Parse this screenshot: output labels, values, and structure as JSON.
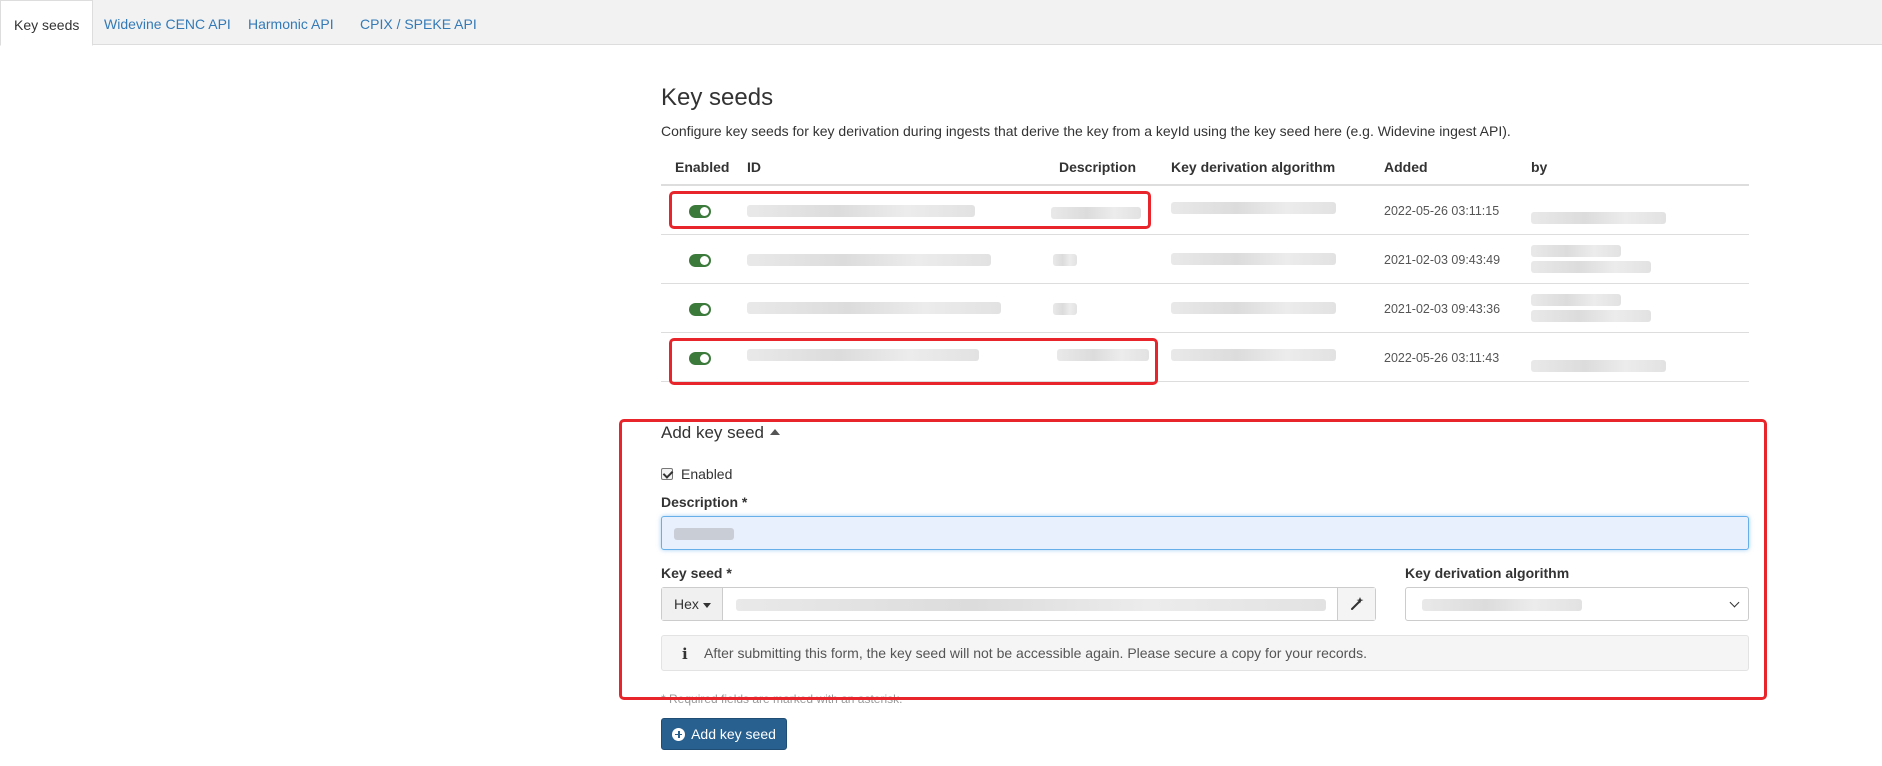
{
  "tabs": [
    {
      "label": "Key seeds",
      "active": true
    },
    {
      "label": "Widevine CENC API",
      "active": false
    },
    {
      "label": "Harmonic API",
      "active": false
    },
    {
      "label": "CPIX / SPEKE API",
      "active": false
    }
  ],
  "page": {
    "title": "Key seeds",
    "description": "Configure key seeds for key derivation during ingests that derive the key from a keyId using the key seed here (e.g. Widevine ingest API)."
  },
  "table": {
    "headers": {
      "enabled": "Enabled",
      "id": "ID",
      "description": "Description",
      "algorithm": "Key derivation algorithm",
      "added": "Added",
      "by": "by"
    },
    "rows": [
      {
        "enabled": true,
        "added": "2022-05-26 03:11:15"
      },
      {
        "enabled": true,
        "added": "2021-02-03 09:43:49"
      },
      {
        "enabled": true,
        "added": "2021-02-03 09:43:36"
      },
      {
        "enabled": true,
        "added": "2022-05-26 03:11:43"
      }
    ]
  },
  "form": {
    "title": "Add key seed",
    "enabled_label": "Enabled",
    "description_label": "Description *",
    "key_seed_label": "Key seed *",
    "format_label": "Hex",
    "algorithm_label": "Key derivation algorithm",
    "info_text": "After submitting this form, the key seed will not be accessible again. Please secure a copy for your records.",
    "required_note": "* Required fields are marked with an asterisk.",
    "submit_label": "Add key seed"
  },
  "colors": {
    "accent": "#286090",
    "link": "#337ab7",
    "toggle_on": "#3c7a3c",
    "annotation": "#e8252a"
  }
}
